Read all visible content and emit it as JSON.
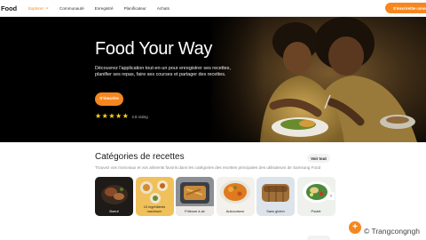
{
  "nav": {
    "logo": "Food",
    "items": [
      {
        "label": "Explorer",
        "active": true
      },
      {
        "label": "Communauté",
        "active": false
      },
      {
        "label": "Enregistré",
        "active": false
      },
      {
        "label": "Planificateur",
        "active": false
      },
      {
        "label": "Achats",
        "active": false
      }
    ],
    "cta": "S'inscrire/Se conne"
  },
  "hero": {
    "title": "Food Your Way",
    "description": "Découvrez l'application tout-en-un pour enregistrer ses recettes, planifier ses repas, faire ses courses et partager des recettes.",
    "button": "S'inscrire",
    "rating_stars": 5,
    "rating_text": "4.8 rating"
  },
  "categories": {
    "title": "Catégories de recettes",
    "see_all": "Voir tout",
    "subtitle": "Trouvez vos morceaux et vos aliments favoris dans les catégories des recettes principales des utilisateurs de Samsung Food",
    "items": [
      {
        "label": "Boeuf",
        "light": true
      },
      {
        "label": "10 ingrédients maximum",
        "light": false
      },
      {
        "label": "Friteuse à air",
        "light": false
      },
      {
        "label": "Autocuiseur",
        "light": false
      },
      {
        "label": "Sans gluten",
        "light": false
      },
      {
        "label": "Poulet",
        "light": false
      }
    ],
    "next_arrow": "›"
  },
  "colors": {
    "accent": "#f6871f",
    "hero_bg": "#000000",
    "star": "#ffd21f"
  },
  "fab": "+",
  "watermark": "© Trangcongngh"
}
